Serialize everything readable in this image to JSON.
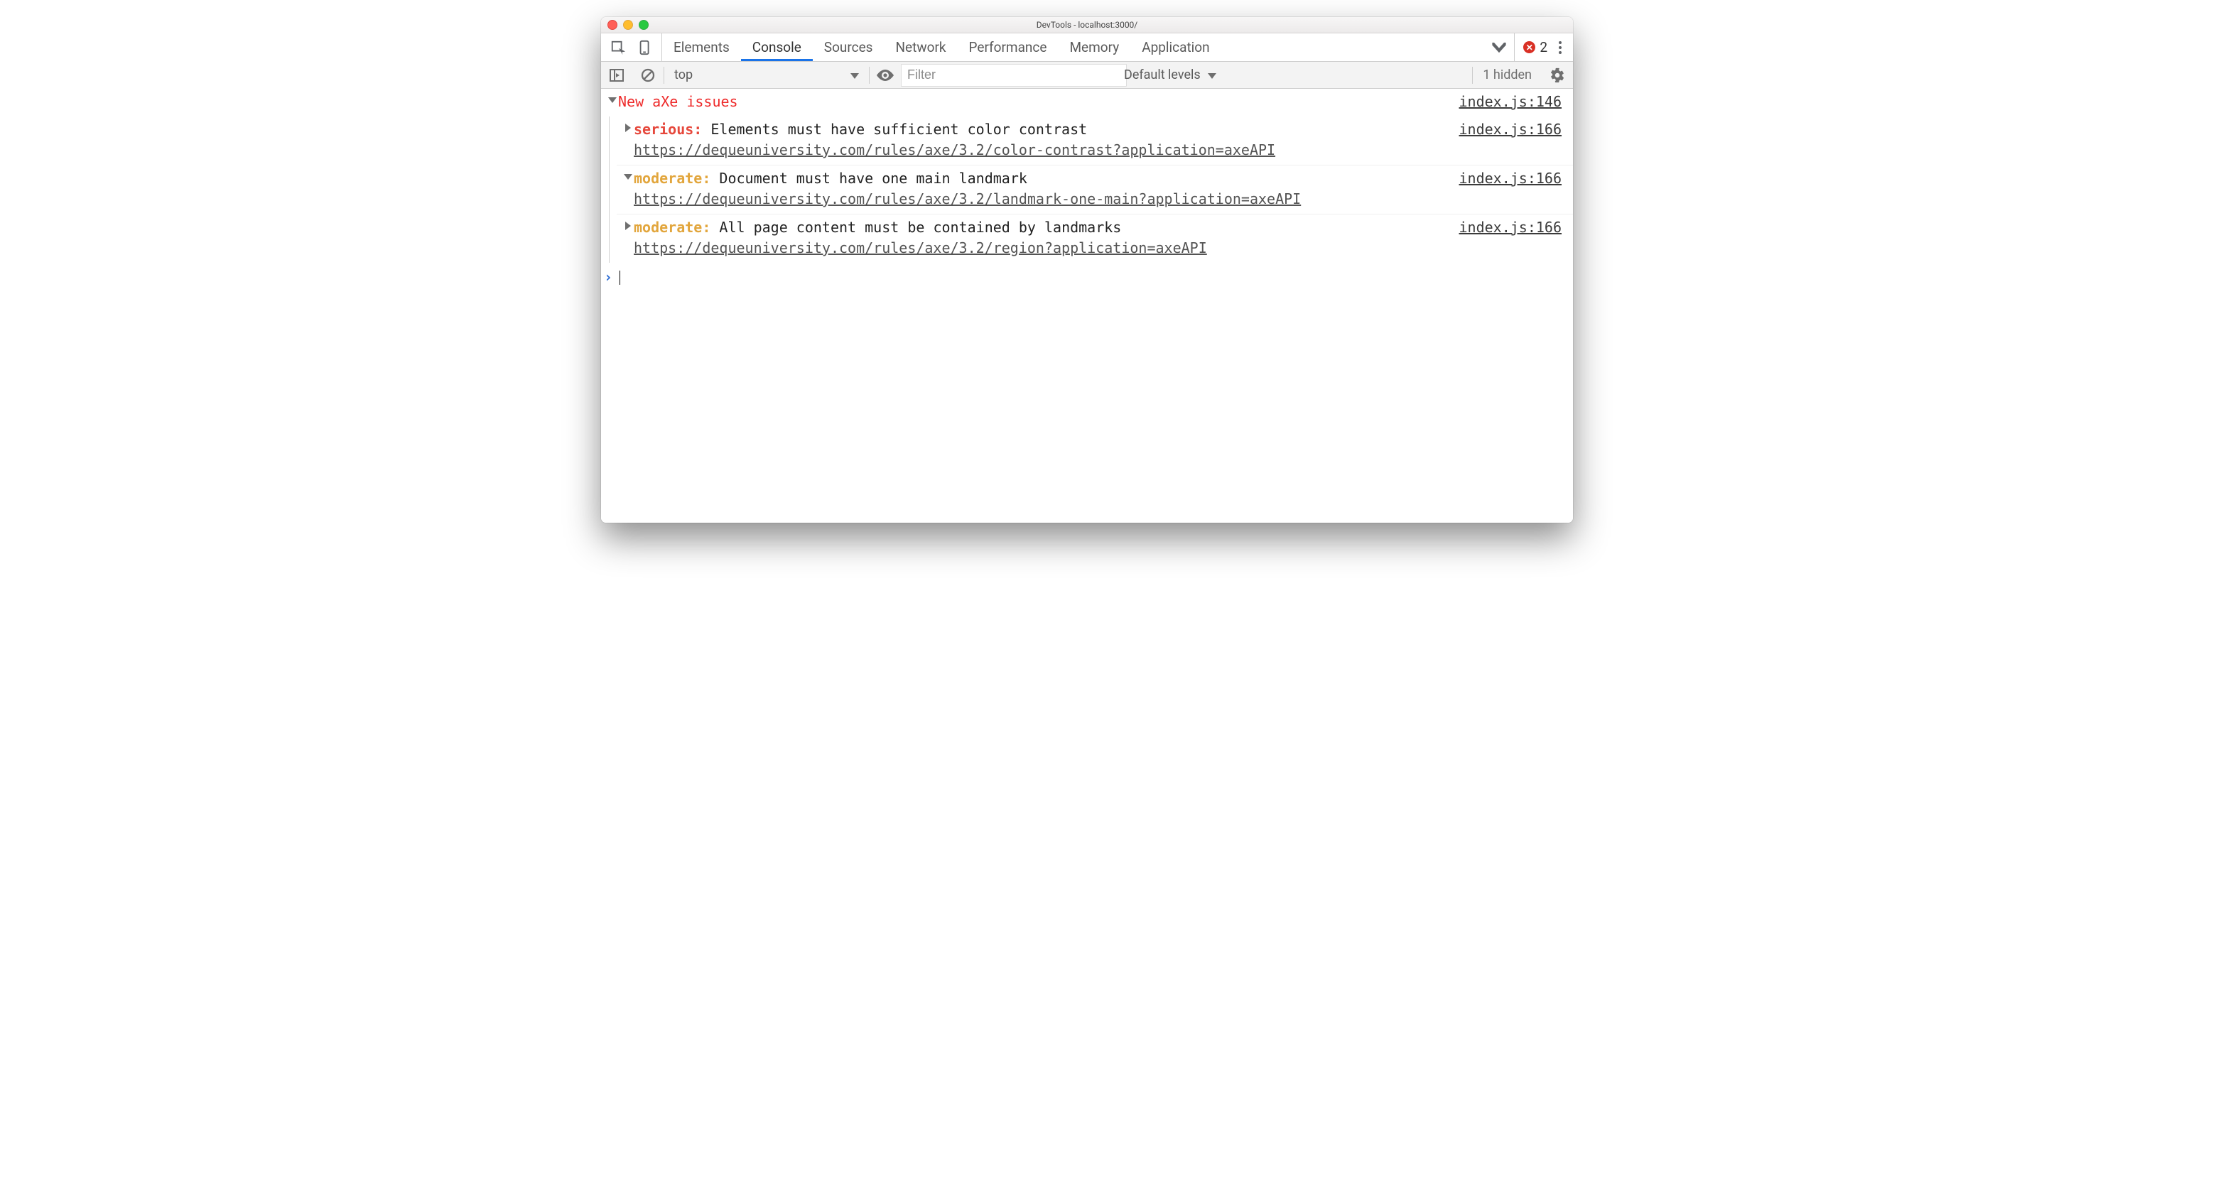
{
  "window": {
    "title": "DevTools - localhost:3000/"
  },
  "tabs": {
    "items": [
      "Elements",
      "Console",
      "Sources",
      "Network",
      "Performance",
      "Memory",
      "Application"
    ],
    "active_index": 1,
    "error_count": "2"
  },
  "toolbar": {
    "context": "top",
    "filter_placeholder": "Filter",
    "levels": "Default levels",
    "hidden": "1 hidden"
  },
  "group": {
    "title": "New aXe issues",
    "source": "index.js:146"
  },
  "issues": [
    {
      "expanded": false,
      "severity": "serious",
      "severity_class": "sev-serious",
      "text": "Elements must have sufficient color contrast",
      "link": "https://dequeuniversity.com/rules/axe/3.2/color-contrast?application=axeAPI",
      "source": "index.js:166"
    },
    {
      "expanded": true,
      "severity": "moderate",
      "severity_class": "sev-moderate",
      "text": "Document must have one main landmark",
      "link": "https://dequeuniversity.com/rules/axe/3.2/landmark-one-main?application=axeAPI",
      "source": "index.js:166"
    },
    {
      "expanded": false,
      "severity": "moderate",
      "severity_class": "sev-moderate",
      "text": "All page content must be contained by landmarks",
      "link": "https://dequeuniversity.com/rules/axe/3.2/region?application=axeAPI",
      "source": "index.js:166"
    }
  ]
}
